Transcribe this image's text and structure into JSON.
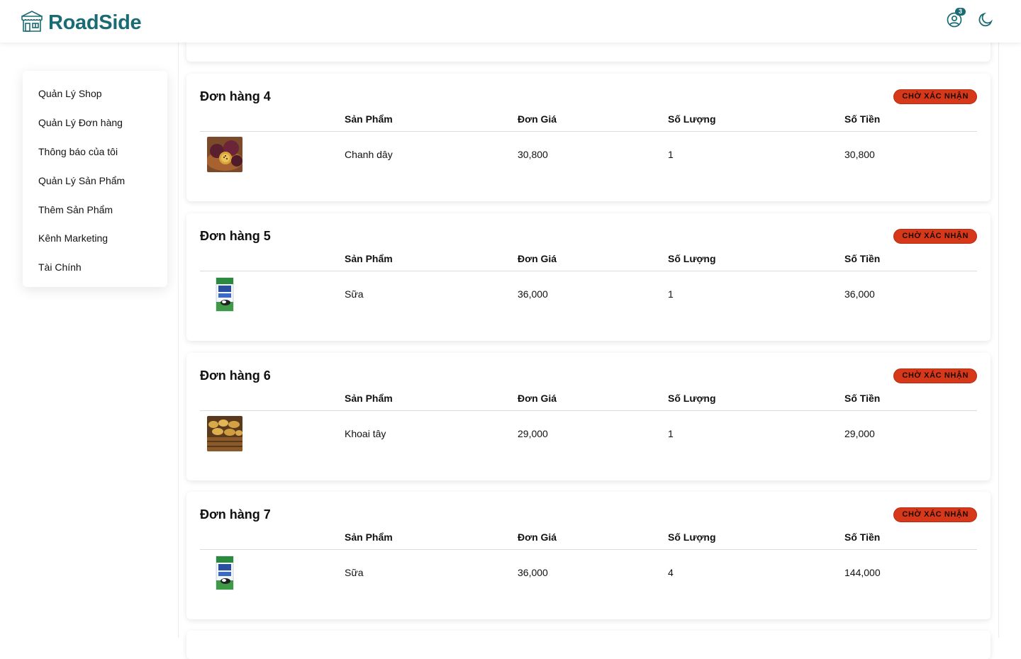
{
  "header": {
    "brand": "RoadSide",
    "logo_icon": "storefront-icon",
    "notification_count": "3",
    "colors": {
      "brand": "#1a6b73",
      "status": "#d7381a"
    }
  },
  "sidebar": {
    "items": [
      {
        "label": "Quản Lý Shop"
      },
      {
        "label": "Quản Lý Đơn hàng"
      },
      {
        "label": "Thông báo của tôi"
      },
      {
        "label": "Quản Lý Sản Phẩm"
      },
      {
        "label": "Thêm Sản Phẩm"
      },
      {
        "label": "Kênh Marketing"
      },
      {
        "label": "Tài Chính"
      }
    ]
  },
  "table_headers": {
    "product": "Sản Phẩm",
    "unit_price": "Đơn Giá",
    "quantity": "Số Lượng",
    "amount": "Số Tiền"
  },
  "orders": [
    {
      "title": "Đơn hàng 4",
      "status": "CHỜ XÁC NHẬN",
      "items": [
        {
          "image": "passion-fruit-image",
          "name": "Chanh dây",
          "price": "30,800",
          "qty": "1",
          "total": "30,800"
        }
      ]
    },
    {
      "title": "Đơn hàng 5",
      "status": "CHỜ XÁC NHẬN",
      "items": [
        {
          "image": "milk-carton-image",
          "name": "Sữa",
          "price": "36,000",
          "qty": "1",
          "total": "36,000"
        }
      ]
    },
    {
      "title": "Đơn hàng 6",
      "status": "CHỜ XÁC NHẬN",
      "items": [
        {
          "image": "potato-image",
          "name": "Khoai tây",
          "price": "29,000",
          "qty": "1",
          "total": "29,000"
        }
      ]
    },
    {
      "title": "Đơn hàng 7",
      "status": "CHỜ XÁC NHẬN",
      "items": [
        {
          "image": "milk-carton-image",
          "name": "Sữa",
          "price": "36,000",
          "qty": "4",
          "total": "144,000"
        }
      ]
    }
  ]
}
